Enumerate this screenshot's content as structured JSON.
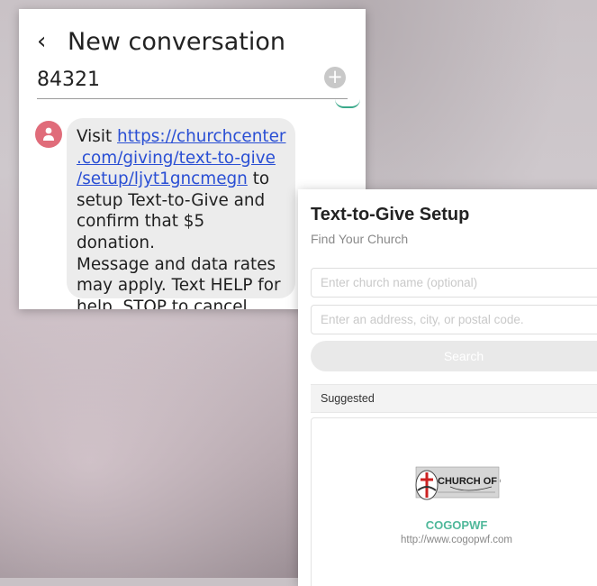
{
  "sms": {
    "title": "New conversation",
    "recipient": "84321",
    "plus_icon": "plus-icon",
    "back_icon": "chevron-left-icon",
    "message": {
      "prefix": "Visit ",
      "link": "https://churchcenter\n.com/giving/text-to-give\n/setup/ljyt1gncmegn",
      "suffix": " to\nsetup Text-to-Give and\nconfirm that $5 donation.\nMessage and data rates\nmay apply. Text HELP for\nhelp, STOP to cancel."
    },
    "avatar_color": "#e06c7a",
    "bubble_color": "#ececec"
  },
  "ttg": {
    "title": "Text-to-Give Setup",
    "subtitle": "Find Your Church",
    "name_placeholder": "Enter church name (optional)",
    "address_placeholder": "Enter an address, city, or postal code.",
    "search_label": "Search",
    "suggested_label": "Suggested",
    "church": {
      "name": "COGOPWF",
      "url": "http://www.cogopwf.com",
      "logo_text": "CHURCH OF GOD"
    },
    "accent": "#4fb89a"
  }
}
